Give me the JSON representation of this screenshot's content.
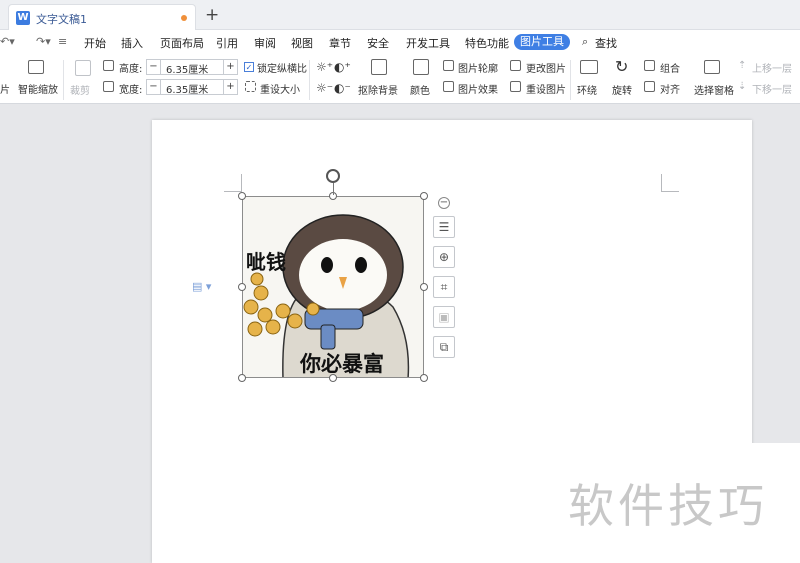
{
  "tabbar": {
    "doc_title": "文字文稿1",
    "doc_icon": "W",
    "new_tab": "+"
  },
  "menu": {
    "items": [
      "开始",
      "插入",
      "页面布局",
      "引用",
      "审阅",
      "视图",
      "章节",
      "安全",
      "开发工具",
      "特色功能"
    ],
    "active": "图片工具",
    "search": "查找"
  },
  "ribbon": {
    "left_cut": "片",
    "smart_scale": "智能缩放",
    "crop": "裁剪",
    "height_label": "高度:",
    "height_value": "6.35厘米",
    "width_label": "宽度:",
    "width_value": "6.35厘米",
    "lock_ratio": "锁定纵横比",
    "reset_size": "重设大小",
    "remove_bg": "抠除背景",
    "color": "颜色",
    "pic_outline": "图片轮廓",
    "pic_effect": "图片效果",
    "change_pic": "更改图片",
    "reset_pic": "重设图片",
    "wrap": "环绕",
    "rotate": "旋转",
    "group": "组合",
    "align": "对齐",
    "selection_pane": "选择窗格",
    "bring_forward": "上移一层",
    "send_backward": "下移一层"
  },
  "document": {
    "caption_top": "呲钱",
    "caption_bottom": "你必暴富"
  },
  "watermark": "软件技巧",
  "colors": {
    "accent": "#3f7fe4",
    "modified_dot": "#f0903a"
  }
}
